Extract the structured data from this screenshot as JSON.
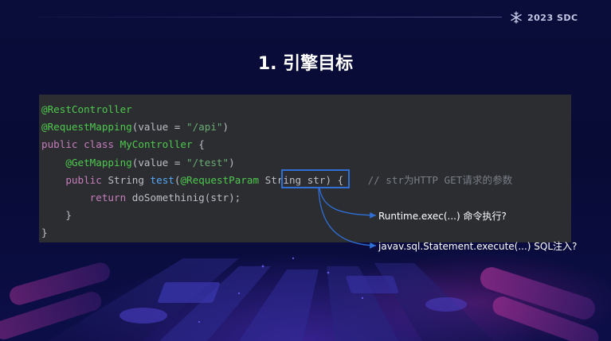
{
  "header": {
    "logo_text": "2023 SDC",
    "logo_icon": "snowflake-icon"
  },
  "slide": {
    "title": "1. 引擎目标"
  },
  "code": {
    "line1": "@RestController",
    "line2_ann": "@RequestMapping",
    "line2_open": "(value = ",
    "line2_str": "\"/api\"",
    "line2_close": ")",
    "line3_kw1": "public",
    "line3_kw2": "class",
    "line3_name": "MyController",
    "line3_brace": "{",
    "line4_ann": "@GetMapping",
    "line4_open": "(value = ",
    "line4_str": "\"/test\"",
    "line4_close": ")",
    "line5_kw": "public",
    "line5_type": "String",
    "line5_method": "test",
    "line5_paren": "(",
    "line5_ann": "@RequestParam",
    "line5_param": "String str",
    "line5_close": ") {",
    "line5_comment": "// str为HTTP GET请求的参数",
    "line6_kw": "return",
    "line6_call": "doSomethinig(str);",
    "line7": "}",
    "line8": "}"
  },
  "annotations": {
    "note1": "Runtime.exec(...) 命令执行?",
    "note2": "javav.sql.Statement.execute(...) SQL注入?"
  },
  "colors": {
    "background": "#080b34",
    "code_bg": "#2b2d31",
    "highlight": "#2f6fd6",
    "annotation_color": "#4ec94e",
    "keyword_color": "#c77dbb",
    "method_color": "#56a8f5",
    "string_color": "#6aab73"
  }
}
